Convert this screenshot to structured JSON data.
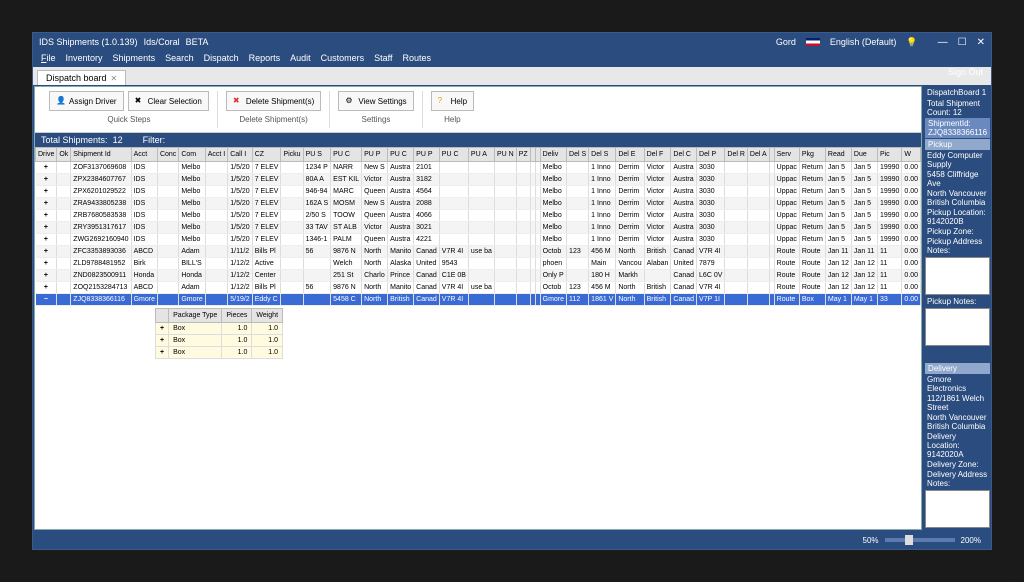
{
  "title": {
    "app": "IDS Shipments (1.0.139)",
    "sub1": "Ids/Coral",
    "sub2": "BETA"
  },
  "user": "Gord",
  "lang": "English (Default)",
  "signout": "Sign Out",
  "menu": [
    "File",
    "Inventory",
    "Shipments",
    "Search",
    "Dispatch",
    "Reports",
    "Audit",
    "Customers",
    "Staff",
    "Routes"
  ],
  "tab": "Dispatch board",
  "toolbar": {
    "assign": "Assign Driver",
    "clear": "Clear Selection",
    "delete": "Delete Shipment(s)",
    "view": "View Settings",
    "help": "Help",
    "grp_quick": "Quick Steps",
    "grp_delete": "Delete Shipment(s)",
    "grp_settings": "Settings",
    "grp_help": "Help"
  },
  "summary": {
    "total_lbl": "Total Shipments:",
    "total_val": "12",
    "filter_lbl": "Filter:"
  },
  "columns": [
    "Drive",
    "Ok",
    "Shipment Id",
    "Acct",
    "Conc",
    "Com",
    "Acct I",
    "Call I",
    "CZ",
    "Picku",
    "PU S",
    "PU C",
    "PU P",
    "PU C",
    "PU P",
    "PU C",
    "PU A",
    "PU N",
    "PZ",
    "",
    "",
    "Deliv",
    "Del S",
    "Del S",
    "Del E",
    "Del F",
    "Del C",
    "Del P",
    "Del R",
    "Del A",
    "",
    "Serv",
    "Pkg",
    "Read",
    "Due",
    "Pic",
    "W"
  ],
  "rows": [
    {
      "exp": "+",
      "id": "ZOF3137069608",
      "acct": "IDS",
      "com": "Melbo",
      "call": "1/5/20",
      "cz": "7 ELEV",
      "pk1": "1234 P",
      "pk2": "NARR",
      "pk3": "New S",
      "pk4": "Austra",
      "pk5": "2101",
      "dl": "Melbo",
      "d1": "1 Inno",
      "d2": "Derrim",
      "d3": "Victor",
      "d4": "Austra",
      "d5": "3030",
      "srv": "Uppac",
      "pkg": "Return",
      "rd": "Jan 5",
      "du": "Jan 5",
      "pc": "19990",
      "wt": "0.00"
    },
    {
      "exp": "+",
      "id": "ZPX2384607767",
      "acct": "IDS",
      "com": "Melbo",
      "call": "1/5/20",
      "cz": "7 ELEV",
      "pk1": "80A A",
      "pk2": "EST KIL",
      "pk3": "Victor",
      "pk4": "Austra",
      "pk5": "3182",
      "dl": "Melbo",
      "d1": "1 Inno",
      "d2": "Derrim",
      "d3": "Victor",
      "d4": "Austra",
      "d5": "3030",
      "srv": "Uppac",
      "pkg": "Return",
      "rd": "Jan 5",
      "du": "Jan 5",
      "pc": "19990",
      "wt": "0.00"
    },
    {
      "exp": "+",
      "id": "ZPX6201029522",
      "acct": "IDS",
      "com": "Melbo",
      "call": "1/5/20",
      "cz": "7 ELEV",
      "pk1": "946-94",
      "pk2": "MARC",
      "pk3": "Queen",
      "pk4": "Austra",
      "pk5": "4564",
      "dl": "Melbo",
      "d1": "1 Inno",
      "d2": "Derrim",
      "d3": "Victor",
      "d4": "Austra",
      "d5": "3030",
      "srv": "Uppac",
      "pkg": "Return",
      "rd": "Jan 5",
      "du": "Jan 5",
      "pc": "19990",
      "wt": "0.00"
    },
    {
      "exp": "+",
      "id": "ZRA9433805238",
      "acct": "IDS",
      "com": "Melbo",
      "call": "1/5/20",
      "cz": "7 ELEV",
      "pk1": "162A S",
      "pk2": "MOSM",
      "pk3": "New S",
      "pk4": "Austra",
      "pk5": "2088",
      "dl": "Melbo",
      "d1": "1 Inno",
      "d2": "Derrim",
      "d3": "Victor",
      "d4": "Austra",
      "d5": "3030",
      "srv": "Uppac",
      "pkg": "Return",
      "rd": "Jan 5",
      "du": "Jan 5",
      "pc": "19990",
      "wt": "0.00"
    },
    {
      "exp": "+",
      "id": "ZRB7680583538",
      "acct": "IDS",
      "com": "Melbo",
      "call": "1/5/20",
      "cz": "7 ELEV",
      "pk1": "2/50 S",
      "pk2": "TOOW",
      "pk3": "Queen",
      "pk4": "Austra",
      "pk5": "4066",
      "dl": "Melbo",
      "d1": "1 Inno",
      "d2": "Derrim",
      "d3": "Victor",
      "d4": "Austra",
      "d5": "3030",
      "srv": "Uppac",
      "pkg": "Return",
      "rd": "Jan 5",
      "du": "Jan 5",
      "pc": "19990",
      "wt": "0.00"
    },
    {
      "exp": "+",
      "id": "ZRY3951317617",
      "acct": "IDS",
      "com": "Melbo",
      "call": "1/5/20",
      "cz": "7 ELEV",
      "pk1": "33 TAV",
      "pk2": "ST ALB",
      "pk3": "Victor",
      "pk4": "Austra",
      "pk5": "3021",
      "dl": "Melbo",
      "d1": "1 Inno",
      "d2": "Derrim",
      "d3": "Victor",
      "d4": "Austra",
      "d5": "3030",
      "srv": "Uppac",
      "pkg": "Return",
      "rd": "Jan 5",
      "du": "Jan 5",
      "pc": "19990",
      "wt": "0.00"
    },
    {
      "exp": "+",
      "id": "ZWG2692160940",
      "acct": "IDS",
      "com": "Melbo",
      "call": "1/5/20",
      "cz": "7 ELEV",
      "pk1": "1346-1",
      "pk2": "PALM",
      "pk3": "Queen",
      "pk4": "Austra",
      "pk5": "4221",
      "dl": "Melbo",
      "d1": "1 Inno",
      "d2": "Derrim",
      "d3": "Victor",
      "d4": "Austra",
      "d5": "3030",
      "srv": "Uppac",
      "pkg": "Return",
      "rd": "Jan 5",
      "du": "Jan 5",
      "pc": "19990",
      "wt": "0.00"
    },
    {
      "exp": "+",
      "id": "ZFC3353893036",
      "acct": "ABCD",
      "com": "Adam",
      "call": "1/11/2",
      "cz": "Bills Pl",
      "pk1": "56",
      "pk2": "9876 N",
      "pk3": "North",
      "pk4": "Manito",
      "pk5": "Canad",
      "pk6": "V7R 4I",
      "pk7": "use ba",
      "dl": "Octob",
      "dn": "123",
      "d1": "456 M",
      "d2": "North",
      "d3": "British",
      "d4": "Canad",
      "d5": "V7R 4I",
      "srv": "Route",
      "pkg": "Route",
      "rd": "Jan 11",
      "du": "Jan 11",
      "pc": "11",
      "wt": "0.00"
    },
    {
      "exp": "+",
      "id": "ZLD9788481952",
      "acct": "Birk",
      "com": "BILL'S",
      "call": "1/12/2",
      "cz": "Active",
      "pk1": "",
      "pk2": "Welch",
      "pk3": "North",
      "pk4": "Alaska",
      "pk5": "United",
      "pk6": "9543",
      "dl": "phoen",
      "d1": "Main",
      "d2": "Vancou",
      "d3": "Alaban",
      "d4": "United",
      "d5": "7879",
      "srv": "Route",
      "pkg": "Route",
      "rd": "Jan 12",
      "du": "Jan 12",
      "pc": "11",
      "wt": "0.00"
    },
    {
      "exp": "+",
      "id": "ZND0823500911",
      "acct": "Honda",
      "com": "Honda",
      "call": "1/12/2",
      "cz": "Center",
      "pk1": "",
      "pk2": "251 St",
      "pk3": "Charlo",
      "pk4": "Prince",
      "pk5": "Canad",
      "pk6": "C1E 0B",
      "dl": "Only P",
      "d1": "180 H",
      "d2": "Markh",
      "d3": "",
      "d4": "Canad",
      "d5": "L6C 0V",
      "srv": "Route",
      "pkg": "Route",
      "rd": "Jan 12",
      "du": "Jan 12",
      "pc": "11",
      "wt": "0.00"
    },
    {
      "exp": "+",
      "id": "ZOQ2153284713",
      "acct": "ABCD",
      "com": "Adam",
      "call": "1/12/2",
      "cz": "Bills Pl",
      "pk1": "56",
      "pk2": "9876 N",
      "pk3": "North",
      "pk4": "Manito",
      "pk5": "Canad",
      "pk6": "V7R 4I",
      "pk7": "use ba",
      "dl": "Octob",
      "dn": "123",
      "d1": "456 M",
      "d2": "North",
      "d3": "British",
      "d4": "Canad",
      "d5": "V7R 4I",
      "srv": "Route",
      "pkg": "Route",
      "rd": "Jan 12",
      "du": "Jan 12",
      "pc": "11",
      "wt": "0.00"
    },
    {
      "exp": "−",
      "id": "ZJQ8338366116",
      "acct": "Gmore",
      "com": "Gmore",
      "call": "5/19/2",
      "cz": "Eddy C",
      "pk1": "",
      "pk2": "5458 C",
      "pk3": "North",
      "pk4": "British",
      "pk5": "Canad",
      "pk6": "V7R 4I",
      "dl": "Gmore",
      "dn": "112",
      "d1": "1861 V",
      "d2": "North",
      "d3": "British",
      "d4": "Canad",
      "d5": "V7P 1I",
      "srv": "Route",
      "pkg": "Box",
      "rd": "May 1",
      "du": "May 1",
      "pc": "33",
      "wt": "0.00",
      "sel": true
    }
  ],
  "subgrid": {
    "cols": [
      "Package Type",
      "Pieces",
      "Weight"
    ],
    "rows": [
      {
        "t": "Box",
        "p": "1.0",
        "w": "1.0"
      },
      {
        "t": "Box",
        "p": "1.0",
        "w": "1.0"
      },
      {
        "t": "Box",
        "p": "1.0",
        "w": "1.0"
      }
    ]
  },
  "sidebar": {
    "board": "DispatchBoard 1",
    "count_lbl": "Total Shipment Count:",
    "count": "12",
    "ship_lbl": "ShipmentId:",
    "ship": "ZJQ8338366116",
    "pickup_hdr": "Pickup",
    "pickup_name": "Eddy Computer Supply",
    "pickup_addr": "5458 Cliffridge Ave",
    "pickup_city": "North Vancouver British Columbia",
    "pickup_loc_lbl": "Pickup Location:",
    "pickup_loc": "9142020B",
    "pickup_zone_lbl": "Pickup Zone:",
    "pickup_notes_lbl": "Pickup Address Notes:",
    "pickup_notes2_lbl": "Pickup Notes:",
    "delivery_hdr": "Delivery",
    "delivery_name": "Gmore Electronics",
    "delivery_addr": "112/1861 Welch Street",
    "delivery_city": "North Vancouver British Columbia",
    "delivery_loc_lbl": "Delivery Location:",
    "delivery_loc": "9142020A",
    "delivery_zone_lbl": "Delivery Zone:",
    "delivery_notes_lbl": "Delivery Address Notes:"
  },
  "zoom": {
    "min": "50%",
    "max": "200%"
  }
}
